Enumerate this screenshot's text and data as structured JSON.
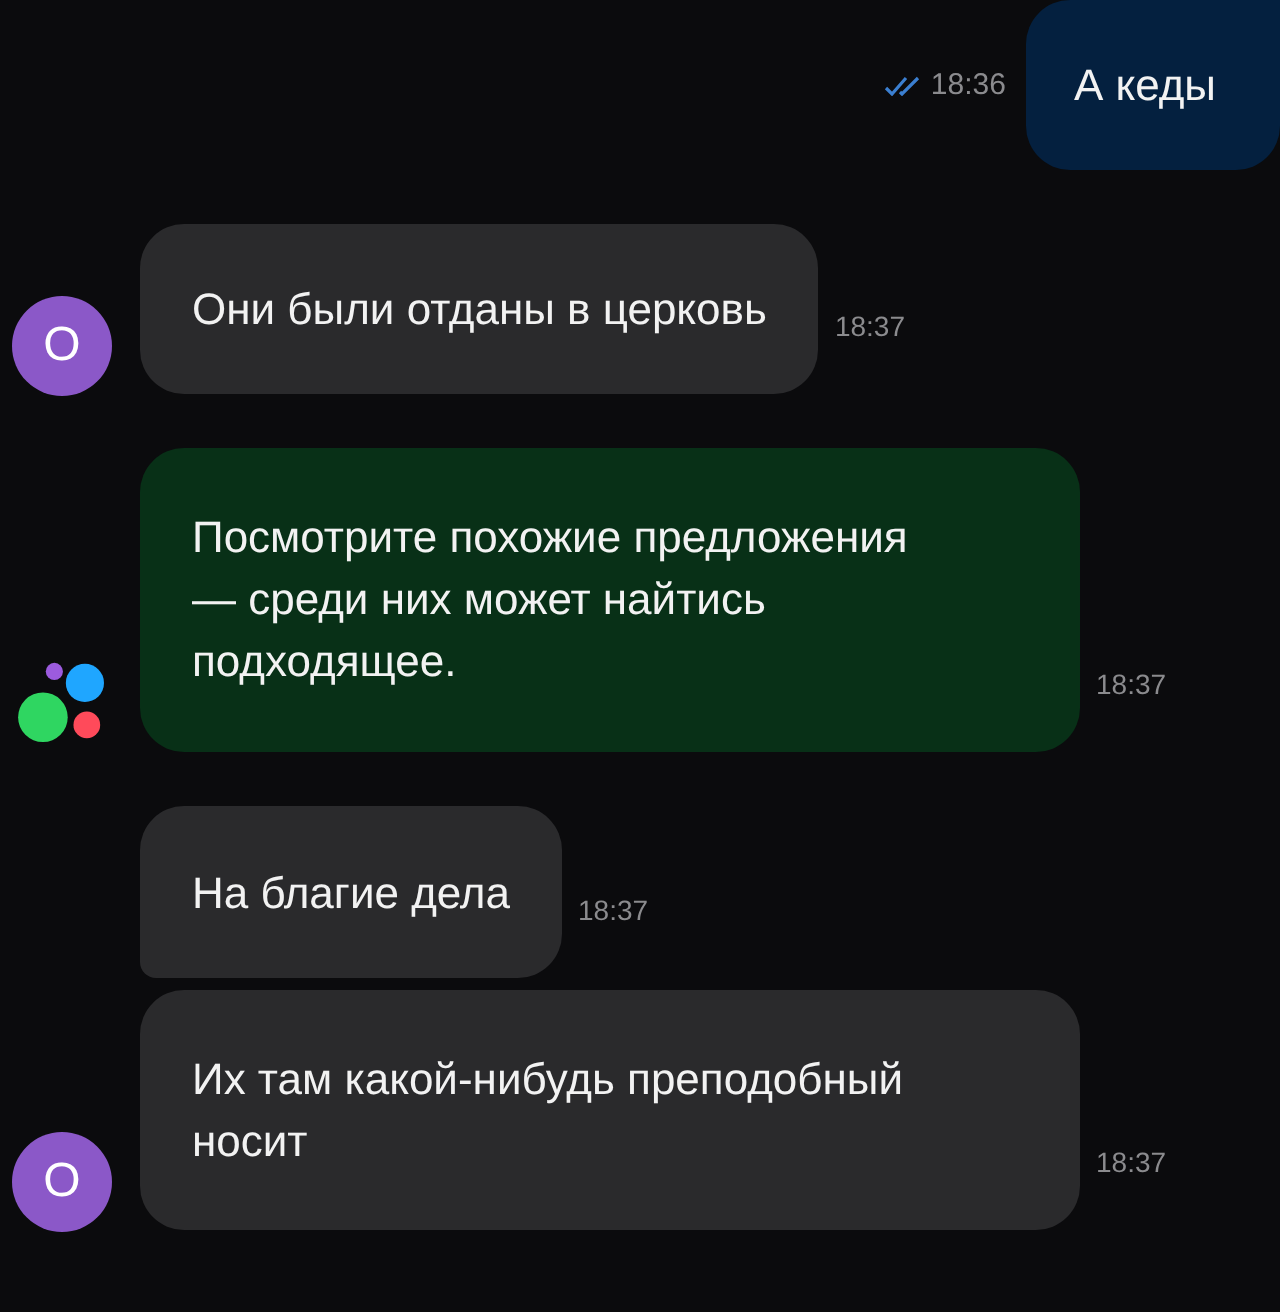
{
  "messages": [
    {
      "kind": "outgoing",
      "text": "А кеды",
      "time": "18:36",
      "read": true
    },
    {
      "kind": "incoming",
      "text": "Они были отданы в церковь",
      "time": "18:37",
      "avatar": "O",
      "grouped": false
    },
    {
      "kind": "bot",
      "text": "Посмотрите похожие предложения — среди них может найтись подходящее.",
      "time": "18:37",
      "grouped": false
    },
    {
      "kind": "incoming",
      "text": "На благие дела",
      "time": "18:37",
      "grouped": true
    },
    {
      "kind": "incoming",
      "text": "Их там какой-нибудь преподобный носит",
      "time": "18:37",
      "avatar": "O",
      "grouped": false
    }
  ]
}
